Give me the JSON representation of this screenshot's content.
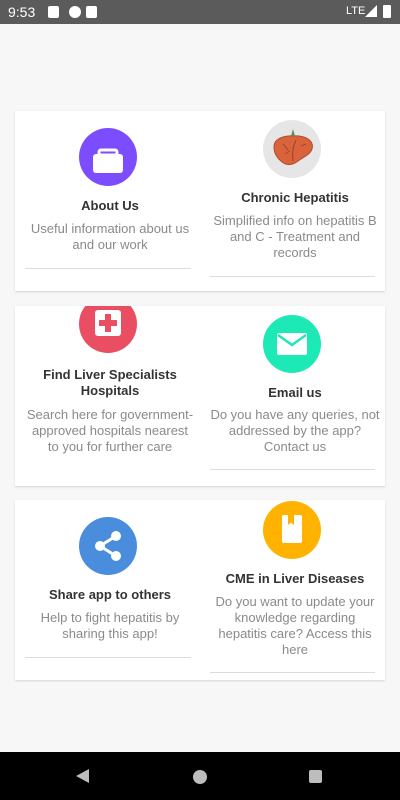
{
  "status_bar": {
    "time": "9:53",
    "network": "LTE",
    "icons": [
      "sd-card-icon",
      "app-notification-icon",
      "app-notification-icon",
      "signal-icon",
      "battery-icon"
    ]
  },
  "menu": {
    "about": {
      "title": "About Us",
      "description": "Useful information about us and our work",
      "icon": "briefcase-icon",
      "color": "#7c4dff"
    },
    "hepatitis": {
      "title": "Chronic Hepatitis",
      "description": "Simplified info on hepatitis B and C - Treatment and records",
      "icon": "liver-icon",
      "color": "#e6e6e6"
    },
    "specialists": {
      "title": "Find Liver Specialists Hospitals",
      "description": "Search here for government-approved hospitals nearest to you for further care",
      "icon": "medical-kit-icon",
      "color": "#e94e63"
    },
    "email": {
      "title": "Email us",
      "description": "Do you have any queries, not addressed by the app? Contact us",
      "icon": "mail-icon",
      "color": "#1de9b6"
    },
    "share": {
      "title": "Share app to others",
      "description": "Help to fight hepatitis by sharing this app!",
      "icon": "share-icon",
      "color": "#4a8ddc"
    },
    "cme": {
      "title": "CME in Liver Diseases",
      "description": "Do you want to update your knowledge regarding hepatitis care? Access this here",
      "icon": "book-icon",
      "color": "#ffb300"
    }
  },
  "nav_bar": {
    "buttons": [
      "back-icon",
      "home-icon",
      "recent-apps-icon"
    ]
  }
}
